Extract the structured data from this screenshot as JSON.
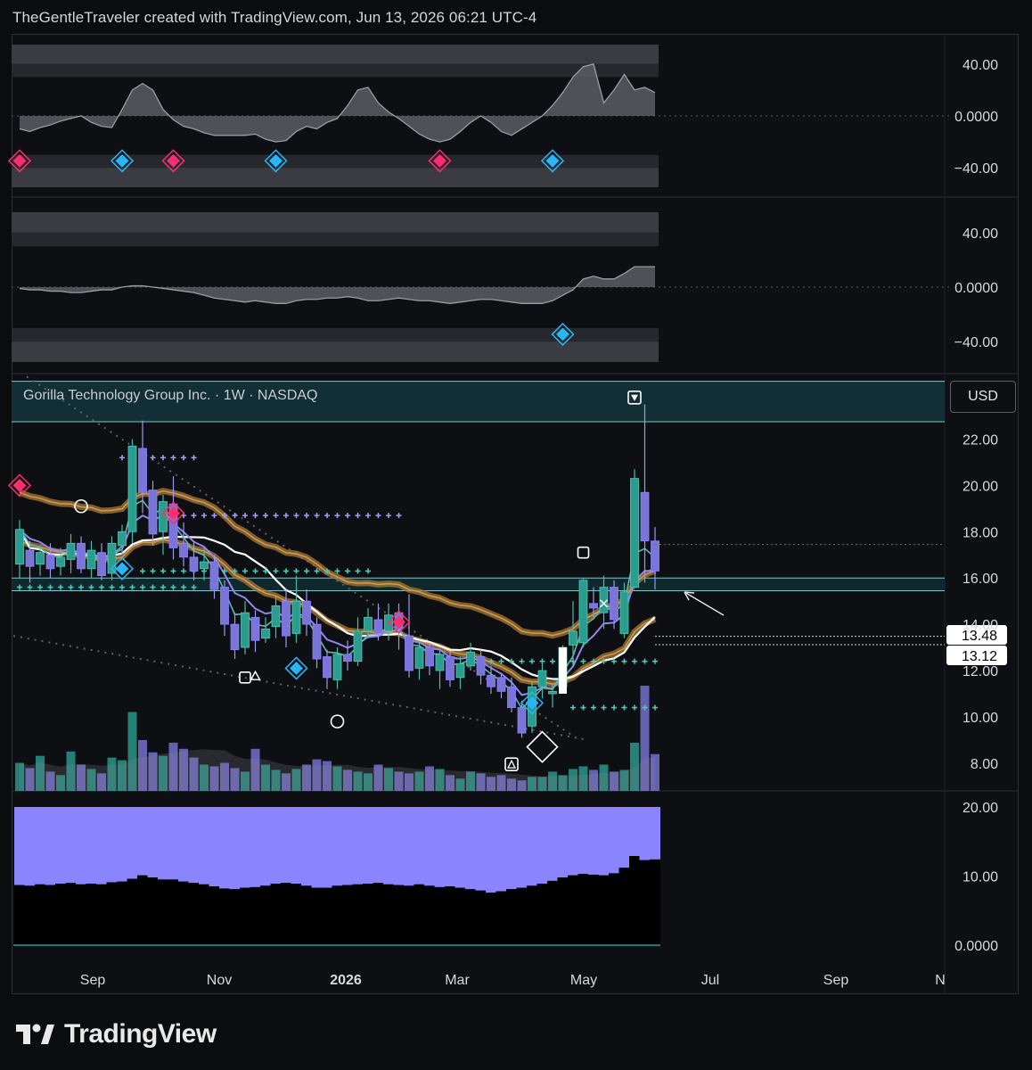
{
  "header": {
    "text": "TheGentleTraveler created with TradingView.com, Jun 13, 2026 06:21 UTC-4"
  },
  "footer": {
    "brand": "TradingView",
    "logo_icon": "tradingview-logo-icon"
  },
  "currency_button": {
    "label": "USD"
  },
  "colors": {
    "background": "#0d0f13",
    "up_candle": "#2a9d8f",
    "down_candle": "#7b75d8",
    "ma_white": "#ffffff",
    "ma_purple": "#8f87f0",
    "ma_teal": "#5fb8a8",
    "ribbon": "#a97a36",
    "signal_red": "#ff2d6f",
    "signal_blue": "#29b6f6",
    "bar_purple": "#8a84ff"
  },
  "chart_data": [
    {
      "type": "area",
      "pane": "oscillator-1",
      "y_ticks": [
        "40.00",
        "0.0000",
        "−40.00"
      ],
      "ylim": [
        -55,
        55
      ],
      "values": [
        -10,
        -12,
        -9,
        -7,
        -4,
        -2,
        0,
        -5,
        -8,
        -9,
        5,
        20,
        25,
        20,
        5,
        -3,
        -8,
        -10,
        -13,
        -15,
        -15,
        -15,
        -15,
        -14,
        -18,
        -20,
        -19,
        -12,
        -8,
        -10,
        -5,
        -2,
        8,
        20,
        22,
        10,
        3,
        -2,
        -8,
        -14,
        -18,
        -20,
        -18,
        -12,
        -5,
        0,
        -5,
        -12,
        -15,
        -10,
        -5,
        0,
        8,
        18,
        30,
        38,
        40,
        10,
        20,
        32,
        20,
        22,
        18
      ],
      "markers": [
        {
          "index": 0,
          "kind": "red-diamond"
        },
        {
          "index": 10,
          "kind": "blue-diamond"
        },
        {
          "index": 15,
          "kind": "red-diamond"
        },
        {
          "index": 25,
          "kind": "blue-diamond"
        },
        {
          "index": 41,
          "kind": "red-diamond"
        },
        {
          "index": 52,
          "kind": "blue-diamond"
        }
      ]
    },
    {
      "type": "area",
      "pane": "oscillator-2",
      "y_ticks": [
        "40.00",
        "0.0000",
        "−40.00"
      ],
      "ylim": [
        -55,
        55
      ],
      "values": [
        -1,
        -2,
        -2,
        -3,
        -3,
        -4,
        -4,
        -3,
        -2,
        -2,
        0,
        1,
        1,
        0,
        -1,
        -2,
        -3,
        -4,
        -6,
        -8,
        -9,
        -10,
        -11,
        -10,
        -11,
        -12,
        -12,
        -10,
        -9,
        -9,
        -8,
        -8,
        -7,
        -8,
        -10,
        -10,
        -9,
        -8,
        -9,
        -10,
        -10,
        -11,
        -12,
        -11,
        -10,
        -9,
        -9,
        -10,
        -11,
        -12,
        -12,
        -12,
        -10,
        -6,
        -2,
        6,
        8,
        6,
        6,
        10,
        15,
        15,
        15
      ],
      "markers": [
        {
          "index": 53,
          "kind": "blue-diamond"
        }
      ]
    },
    {
      "type": "candlestick",
      "pane": "price",
      "title": "Gorilla Technology Group Inc. · 1W · NASDAQ",
      "y_ticks": [
        "22.00",
        "20.00",
        "18.00",
        "16.00",
        "14.00",
        "12.00",
        "10.00",
        "8.00"
      ],
      "ylim": [
        6.8,
        24.6
      ],
      "price_labels": [
        "13.48",
        "13.12"
      ],
      "x_ticks": [
        "Sep",
        "Nov",
        "2026",
        "Mar",
        "May",
        "Jul",
        "Sep",
        "N"
      ],
      "candles": [
        [
          16.6,
          18.1,
          18.5,
          16.0
        ],
        [
          17.2,
          16.5,
          17.6,
          15.8
        ],
        [
          16.6,
          17.1,
          17.4,
          16.1
        ],
        [
          17.0,
          16.4,
          17.5,
          16.0
        ],
        [
          16.5,
          16.9,
          17.3,
          16.1
        ],
        [
          16.8,
          17.5,
          17.9,
          16.2
        ],
        [
          17.5,
          16.4,
          17.8,
          16.2
        ],
        [
          16.4,
          17.2,
          17.6,
          16.0
        ],
        [
          17.1,
          16.1,
          17.5,
          15.9
        ],
        [
          16.2,
          17.5,
          17.8,
          15.9
        ],
        [
          17.4,
          18.0,
          18.3,
          17.0
        ],
        [
          18.0,
          21.7,
          22.0,
          17.5
        ],
        [
          21.6,
          19.7,
          22.8,
          18.8
        ],
        [
          19.8,
          17.9,
          20.2,
          17.4
        ],
        [
          18.0,
          19.3,
          19.6,
          17.0
        ],
        [
          19.2,
          17.3,
          20.4,
          16.8
        ],
        [
          17.5,
          16.9,
          18.4,
          16.5
        ],
        [
          16.9,
          16.3,
          17.6,
          15.9
        ],
        [
          16.4,
          16.7,
          17.3,
          15.9
        ],
        [
          16.7,
          15.5,
          17.0,
          15.1
        ],
        [
          15.6,
          14.0,
          15.9,
          13.5
        ],
        [
          14.0,
          12.9,
          14.5,
          12.5
        ],
        [
          13.0,
          14.5,
          15.0,
          12.7
        ],
        [
          14.3,
          13.3,
          14.6,
          12.8
        ],
        [
          13.4,
          13.8,
          14.3,
          13.2
        ],
        [
          13.9,
          14.8,
          15.2,
          13.4
        ],
        [
          15.0,
          13.5,
          15.5,
          13.0
        ],
        [
          13.6,
          15.0,
          16.1,
          13.2
        ],
        [
          15.0,
          14.0,
          15.5,
          13.5
        ],
        [
          14.0,
          12.5,
          14.3,
          12.1
        ],
        [
          12.6,
          11.7,
          12.9,
          11.2
        ],
        [
          11.6,
          12.7,
          13.0,
          11.2
        ],
        [
          12.7,
          12.4,
          13.3,
          12.0
        ],
        [
          12.4,
          13.7,
          14.3,
          12.2
        ],
        [
          13.7,
          14.3,
          14.7,
          13.4
        ],
        [
          14.2,
          13.6,
          14.9,
          13.3
        ],
        [
          13.7,
          14.4,
          14.9,
          13.3
        ],
        [
          14.5,
          13.8,
          14.9,
          12.9
        ],
        [
          13.5,
          12.0,
          15.3,
          11.7
        ],
        [
          12.1,
          13.0,
          13.3,
          11.6
        ],
        [
          13.0,
          12.2,
          13.2,
          11.8
        ],
        [
          12.0,
          12.7,
          12.9,
          11.2
        ],
        [
          12.6,
          11.6,
          12.8,
          11.3
        ],
        [
          11.7,
          12.3,
          12.6,
          11.2
        ],
        [
          12.2,
          12.8,
          13.2,
          12.0
        ],
        [
          12.6,
          11.8,
          12.9,
          11.4
        ],
        [
          11.8,
          11.3,
          12.2,
          11.0
        ],
        [
          11.7,
          11.1,
          11.9,
          10.8
        ],
        [
          11.3,
          10.4,
          11.7,
          10.2
        ],
        [
          10.4,
          9.3,
          10.7,
          9.1
        ],
        [
          9.6,
          11.3,
          11.5,
          9.3
        ],
        [
          11.3,
          12.0,
          12.4,
          10.8
        ],
        [
          11.0,
          11.1,
          11.4,
          10.4
        ],
        [
          11.3,
          13.0,
          13.1,
          11.2
        ],
        [
          13.1,
          13.7,
          15.0,
          12.2
        ],
        [
          13.2,
          15.9,
          16.0,
          13.0
        ],
        [
          14.9,
          14.7,
          15.6,
          14.3
        ],
        [
          14.5,
          15.6,
          16.1,
          13.8
        ],
        [
          15.6,
          14.2,
          15.9,
          13.8
        ],
        [
          13.6,
          15.4,
          15.8,
          13.4
        ],
        [
          15.6,
          20.3,
          20.7,
          15.6
        ],
        [
          19.7,
          17.6,
          23.5,
          15.8
        ],
        [
          17.6,
          16.3,
          18.2,
          15.5
        ]
      ],
      "signal_markers": [
        {
          "index": 0,
          "kind": "red-diamond"
        },
        {
          "index": 10,
          "kind": "blue-diamond"
        },
        {
          "index": 15,
          "kind": "red-diamond"
        },
        {
          "index": 27,
          "kind": "blue-diamond"
        },
        {
          "index": 37,
          "kind": "red-diamond"
        },
        {
          "index": 50,
          "kind": "blue-diamond"
        }
      ],
      "volume": [
        32,
        26,
        40,
        22,
        18,
        45,
        30,
        25,
        20,
        38,
        35,
        90,
        58,
        44,
        40,
        55,
        48,
        38,
        30,
        28,
        32,
        26,
        22,
        48,
        30,
        24,
        20,
        25,
        30,
        36,
        34,
        28,
        24,
        22,
        20,
        30,
        26,
        22,
        20,
        22,
        28,
        25,
        18,
        14,
        22,
        20,
        16,
        18,
        14,
        12,
        16,
        16,
        22,
        18,
        25,
        28,
        24,
        30,
        22,
        24,
        55,
        120,
        42
      ]
    },
    {
      "type": "bar",
      "pane": "ratio",
      "y_ticks": [
        "20.00",
        "10.00",
        "0.0000"
      ],
      "ylim": [
        0,
        20
      ],
      "top_values": [
        20,
        20,
        20,
        20,
        20,
        20,
        20,
        20,
        20,
        20,
        20,
        20,
        20,
        20,
        20,
        20,
        20,
        20,
        20,
        20,
        20,
        20,
        20,
        20,
        20,
        20,
        20,
        20,
        20,
        20,
        20,
        20,
        20,
        20,
        20,
        20,
        20,
        20,
        20,
        20,
        20,
        20,
        20,
        20,
        20,
        20,
        20,
        20,
        20,
        20,
        20,
        20,
        20,
        20,
        20,
        20,
        20,
        20,
        20,
        20,
        20,
        20,
        20
      ],
      "values": [
        8.7,
        8.6,
        8.8,
        8.7,
        8.9,
        9.0,
        8.8,
        8.9,
        8.8,
        9.1,
        9.2,
        9.6,
        10.1,
        9.8,
        9.5,
        9.5,
        9.2,
        9.0,
        8.8,
        8.5,
        8.2,
        8.1,
        8.3,
        8.4,
        8.6,
        8.9,
        9.0,
        8.9,
        8.6,
        8.3,
        8.3,
        8.6,
        8.7,
        8.8,
        8.9,
        9.0,
        8.8,
        8.7,
        8.6,
        8.8,
        8.6,
        8.4,
        8.5,
        8.3,
        8.1,
        7.9,
        7.6,
        7.8,
        8.1,
        8.3,
        8.6,
        8.9,
        9.3,
        9.8,
        10.1,
        10.3,
        10.2,
        10.1,
        10.4,
        11.2,
        12.9,
        12.3,
        12.4
      ]
    }
  ]
}
